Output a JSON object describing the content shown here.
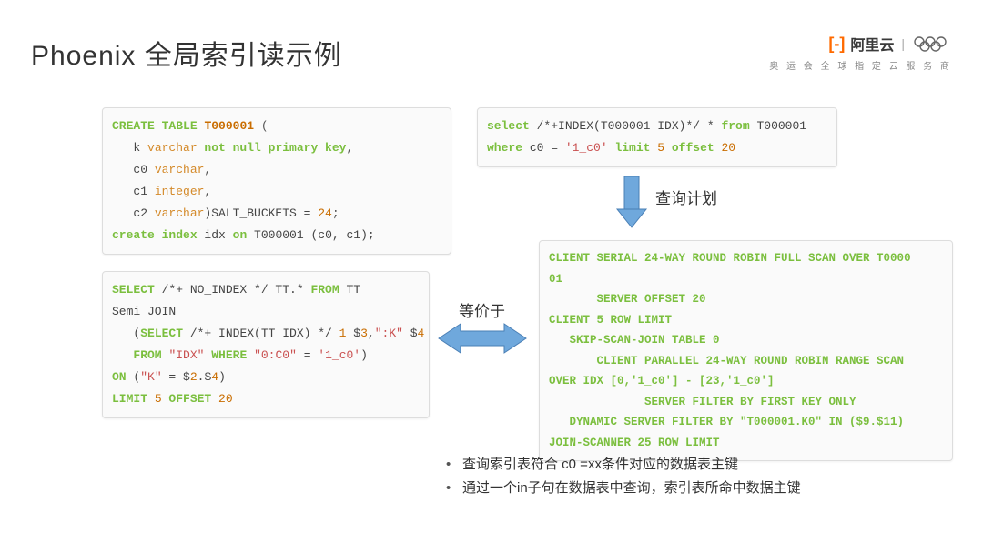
{
  "title": "Phoenix 全局索引读示例",
  "brand": {
    "logo_text": "阿里云",
    "tagline": "奥 运 会 全 球 指 定 云 服 务 商"
  },
  "labels": {
    "equiv": "等价于",
    "plan": "查询计划"
  },
  "bullets": [
    "查询索引表符合  c0 =xx条件对应的数据表主键",
    "通过一个in子句在数据表中查询，索引表所命中数据主键"
  ],
  "code": {
    "create": {
      "l1a": "CREATE TABLE",
      "l1b": "T000001",
      "l1c": "(",
      "l2a": "   k ",
      "l2b": "varchar",
      "l2c": " not null primary key",
      "l2d": ",",
      "l3a": "   c0 ",
      "l3b": "varchar",
      "l3c": ",",
      "l4a": "   c1 ",
      "l4b": "integer",
      "l4c": ",",
      "l5a": "   c2 ",
      "l5b": "varchar",
      "l5c": ")SALT_BUCKETS = ",
      "l5d": "24",
      "l5e": ";",
      "l6a": "create index",
      "l6b": " idx ",
      "l6c": "on",
      "l6d": " T000001 (c0, c1);"
    },
    "select_idx": {
      "l1a": "select",
      "l1b": " /*+INDEX(T000001 IDX)*/ * ",
      "l1c": "from",
      "l1d": " T000001",
      "l2a": "where",
      "l2b": " c0 = ",
      "l2c": "'1_c0'",
      "l2d": " limit",
      "l2e": " 5",
      "l2f": " offset",
      "l2g": " 20"
    },
    "select_noidx": {
      "l1a": "SELECT",
      "l1b": " /*+ NO_INDEX */ TT.* ",
      "l1c": "FROM",
      "l1d": " TT",
      "l2": "Semi JOIN",
      "l3a": "   (",
      "l3b": "SELECT",
      "l3c": " /*+ INDEX(TT IDX) */ ",
      "l3d": "1",
      "l3e": " $",
      "l3f": "3",
      "l3g": ",",
      "l3h": "\":K\"",
      "l3i": " $",
      "l3j": "4",
      "l4a": "   ",
      "l4b": "FROM",
      "l4c": " ",
      "l4d": "\"IDX\"",
      "l4e": " WHERE",
      "l4f": " ",
      "l4g": "\"0:C0\"",
      "l4h": " = ",
      "l4i": "'1_c0'",
      "l4j": ")",
      "l5a": "ON",
      "l5b": " (",
      "l5c": "\"K\"",
      "l5d": " = $",
      "l5e": "2",
      "l5f": ".$",
      "l5g": "4",
      "l5h": ")",
      "l6a": "LIMIT",
      "l6b": " 5",
      "l6c": " OFFSET",
      "l6d": " 20"
    },
    "plan": {
      "l1": "CLIENT SERIAL 24-WAY ROUND ROBIN FULL SCAN OVER T0000",
      "l2": "01",
      "l3": "       SERVER OFFSET 20",
      "l4": "CLIENT 5 ROW LIMIT",
      "l5": "   SKIP-SCAN-JOIN TABLE 0",
      "l6": "       CLIENT PARALLEL 24-WAY ROUND ROBIN RANGE SCAN",
      "l7": "OVER IDX [0,'1_c0'] - [23,'1_c0']",
      "l8": "              SERVER FILTER BY FIRST KEY ONLY",
      "l9": "   DYNAMIC SERVER FILTER BY \"T000001.K0\" IN ($9.$11)",
      "l10": "JOIN-SCANNER 25 ROW LIMIT"
    }
  }
}
